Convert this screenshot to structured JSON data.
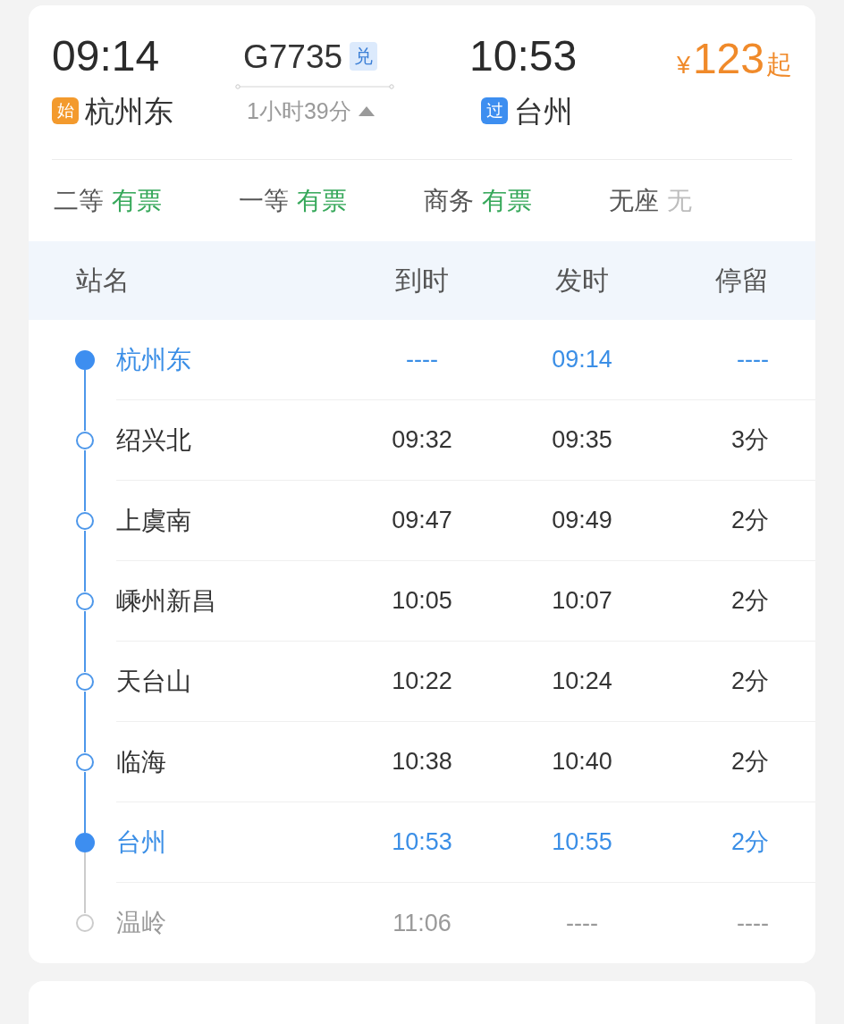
{
  "train": {
    "departure_time": "09:14",
    "number": "G7735",
    "number_badge": "兑",
    "arrival_time": "10:53",
    "price": {
      "currency": "¥",
      "amount": "123",
      "suffix": "起"
    },
    "from": {
      "tag": "始",
      "kind": "origin",
      "name": "杭州东"
    },
    "duration": "1小时39分",
    "expanded": true,
    "to": {
      "tag": "过",
      "kind": "passing",
      "name": "台州"
    }
  },
  "seats": [
    {
      "class": "二等",
      "availability": "有票",
      "available": true
    },
    {
      "class": "一等",
      "availability": "有票",
      "available": true
    },
    {
      "class": "商务",
      "availability": "有票",
      "available": true
    },
    {
      "class": "无座",
      "availability": "无",
      "available": false
    }
  ],
  "timetable": {
    "columns": [
      "站名",
      "到时",
      "发时",
      "停留"
    ],
    "stops": [
      {
        "name": "杭州东",
        "arrive": "----",
        "depart": "09:14",
        "stay": "----",
        "kind": "endpoint"
      },
      {
        "name": "绍兴北",
        "arrive": "09:32",
        "depart": "09:35",
        "stay": "3分",
        "kind": "stop"
      },
      {
        "name": "上虞南",
        "arrive": "09:47",
        "depart": "09:49",
        "stay": "2分",
        "kind": "stop"
      },
      {
        "name": "嵊州新昌",
        "arrive": "10:05",
        "depart": "10:07",
        "stay": "2分",
        "kind": "stop"
      },
      {
        "name": "天台山",
        "arrive": "10:22",
        "depart": "10:24",
        "stay": "2分",
        "kind": "stop"
      },
      {
        "name": "临海",
        "arrive": "10:38",
        "depart": "10:40",
        "stay": "2分",
        "kind": "stop"
      },
      {
        "name": "台州",
        "arrive": "10:53",
        "depart": "10:55",
        "stay": "2分",
        "kind": "endpoint"
      },
      {
        "name": "温岭",
        "arrive": "11:06",
        "depart": "----",
        "stay": "----",
        "kind": "beyond"
      }
    ]
  }
}
